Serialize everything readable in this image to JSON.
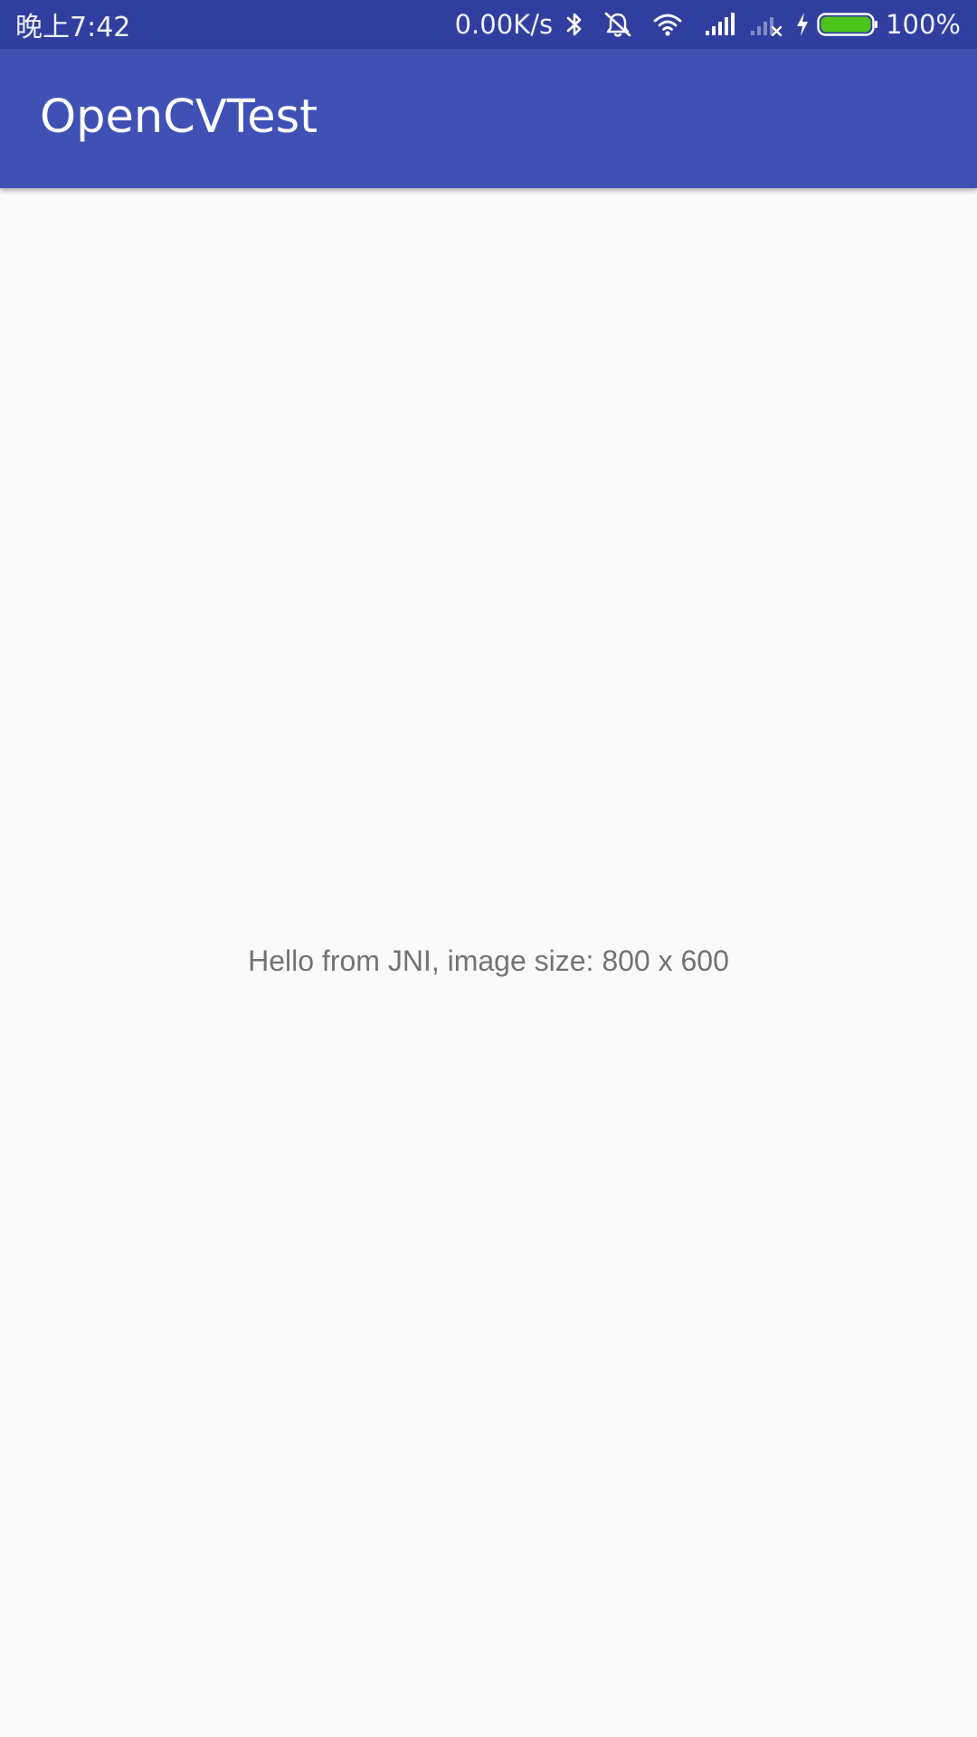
{
  "status_bar": {
    "time": "晚上7:42",
    "net_speed": "0.00K/s",
    "icons": [
      "bluetooth-icon",
      "alarm-off-icon",
      "wifi-icon",
      "signal-icon",
      "signal-no-sim-icon",
      "charging-icon",
      "battery-icon"
    ],
    "battery_percent": "100%",
    "battery_level": 1.0,
    "battery_color": "#4cc419",
    "background_color": "#303f9f"
  },
  "app_bar": {
    "title": "OpenCVTest",
    "background_color": "#3f51b5"
  },
  "main": {
    "message": "Hello from JNI, image size: 800 x 600"
  }
}
